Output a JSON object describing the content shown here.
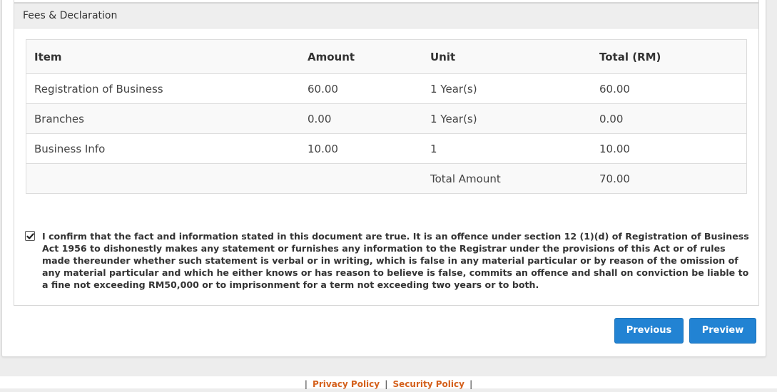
{
  "section": {
    "title": "Fees & Declaration"
  },
  "table": {
    "headers": [
      "Item",
      "Amount",
      "Unit",
      "Total (RM)"
    ],
    "rows": [
      {
        "item": "Registration of Business",
        "amount": "60.00",
        "unit": "1 Year(s)",
        "total": "60.00"
      },
      {
        "item": "Branches",
        "amount": "0.00",
        "unit": "1 Year(s)",
        "total": "0.00"
      },
      {
        "item": "Business Info",
        "amount": "10.00",
        "unit": "1",
        "total": "10.00"
      }
    ],
    "total_label": "Total Amount",
    "total_value": "70.00"
  },
  "declaration": {
    "checked": true,
    "text": "I confirm that the fact and information stated in this document are true. It is an offence under section 12 (1)(d) of Registration of Business Act 1956 to dishonestly makes any statement or furnishes any information to the Registrar under the provisions of this Act or of rules made thereunder whether such statement is verbal or in writing, which is false in any material particular or by reason of the omission of any material particular and which he either knows or has reason to believe is false, commits an offence and shall on conviction be liable to a fine not exceeding RM50,000 or to imprisonment for a term not exceeding two years or to both."
  },
  "buttons": {
    "previous": "Previous",
    "preview": "Preview"
  },
  "footer": {
    "privacy": "Privacy Policy",
    "security": "Security Policy",
    "separator": "|"
  },
  "colors": {
    "button": "#2283d3",
    "link": "#d4601c",
    "panel_heading": "#eeeeee"
  }
}
